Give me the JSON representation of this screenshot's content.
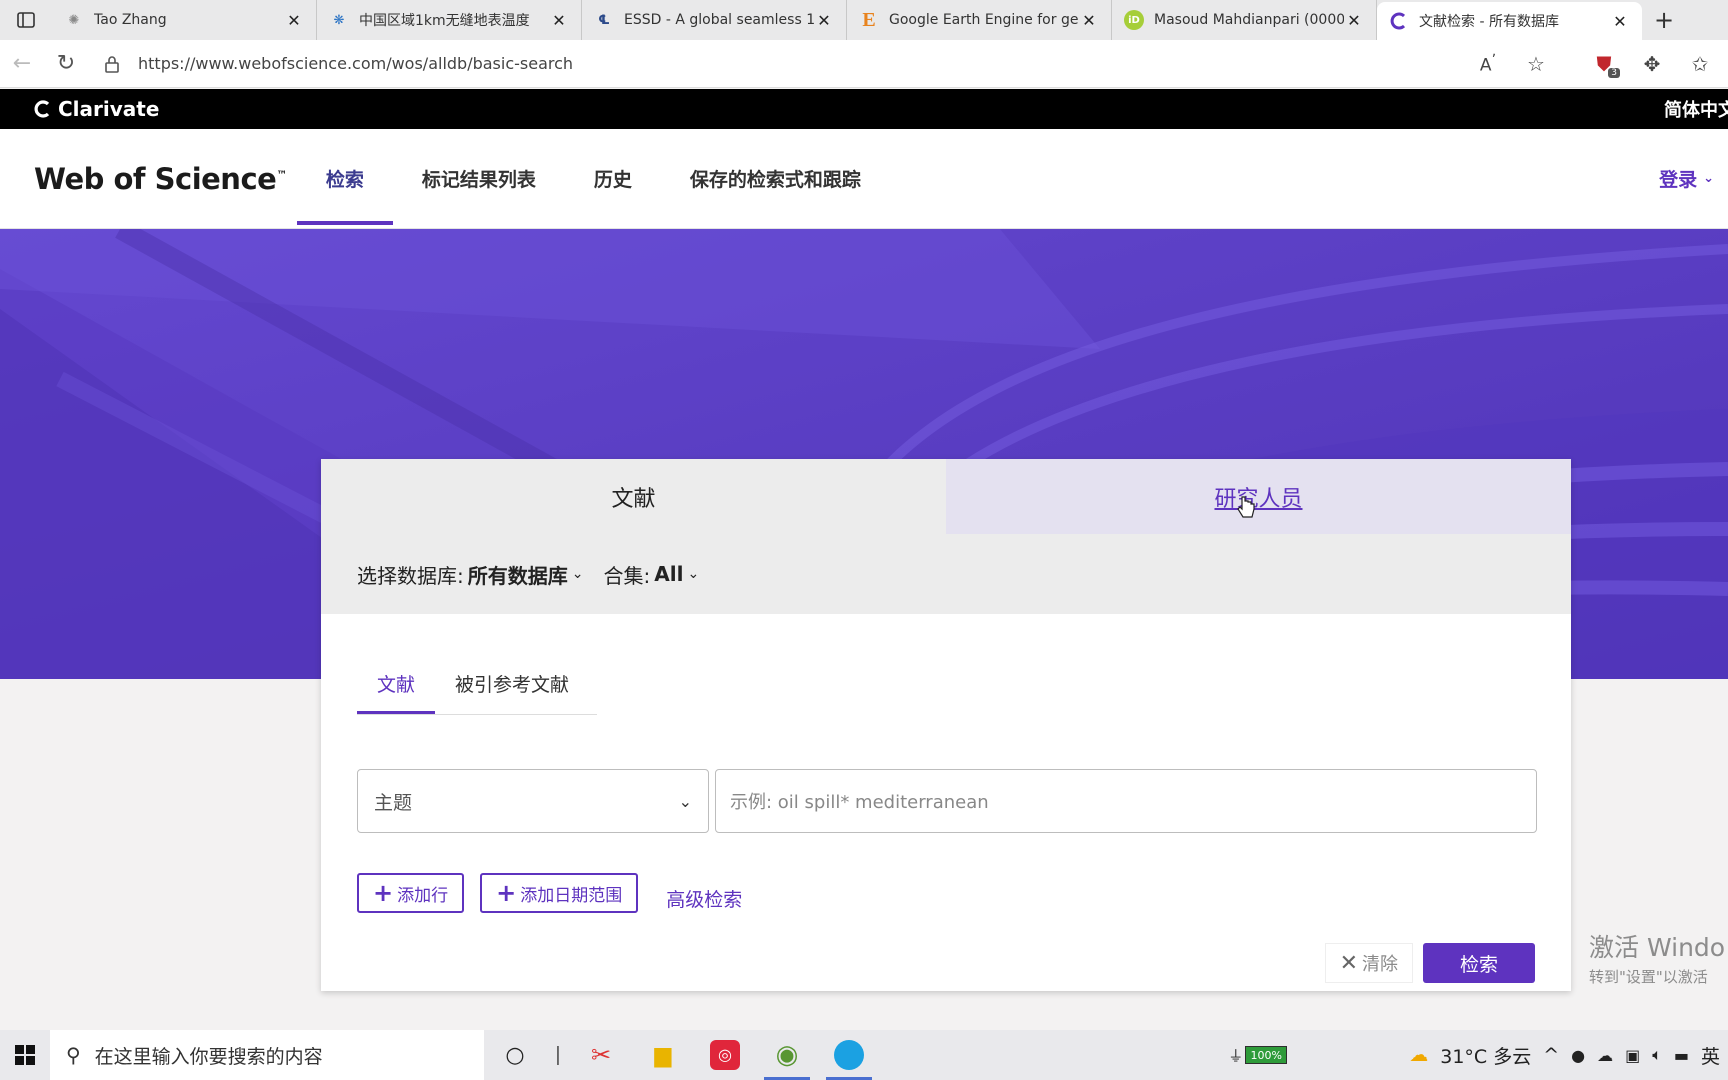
{
  "browser": {
    "tabs": [
      {
        "title": "Tao Zhang",
        "icon": "wiki-logo-icon",
        "active": false
      },
      {
        "title": "中国区域1km无缝地表温度",
        "icon": "data-site-icon",
        "active": false
      },
      {
        "title": "ESSD - A global seamless 1",
        "icon": "essd-icon",
        "active": false
      },
      {
        "title": "Google Earth Engine for ge",
        "icon": "elsevier-e-icon",
        "active": false
      },
      {
        "title": "Masoud Mahdianpari (0000",
        "icon": "orcid-icon",
        "active": false
      },
      {
        "title": "文献检索 - 所有数据库",
        "icon": "clarivate-icon",
        "active": true
      }
    ],
    "url": "https://www.webofscience.com/wos/alldb/basic-search",
    "extension_badge": "3"
  },
  "clarivate": {
    "logo": "Clarivate",
    "language": "简体中文"
  },
  "header": {
    "logo": "Web of Science",
    "logo_tm": "™",
    "nav": [
      "检索",
      "标记结果列表",
      "历史",
      "保存的检索式和跟踪"
    ],
    "login": "登录"
  },
  "search": {
    "tabs": [
      "文献",
      "研究人员"
    ],
    "database_label": "选择数据库:",
    "database_value": "所有数据库",
    "collection_label": "合集:",
    "collection_value": "All",
    "sub_tabs": [
      "文献",
      "被引参考文献"
    ],
    "field_value": "主题",
    "placeholder": "示例: oil spill* mediterranean",
    "add_row": "添加行",
    "add_date": "添加日期范围",
    "advanced": "高级检索",
    "clear": "清除",
    "submit": "检索"
  },
  "watermark": {
    "line1": "激活 Windo",
    "line2": "转到\"设置\"以激活"
  },
  "taskbar": {
    "search_placeholder": "在这里输入你要搜索的内容",
    "battery": "100%",
    "weather": "31°C 多云",
    "ime": "英"
  },
  "colors": {
    "brand_purple": "#5e33bf",
    "hero_purple": "#5c3ec6"
  }
}
